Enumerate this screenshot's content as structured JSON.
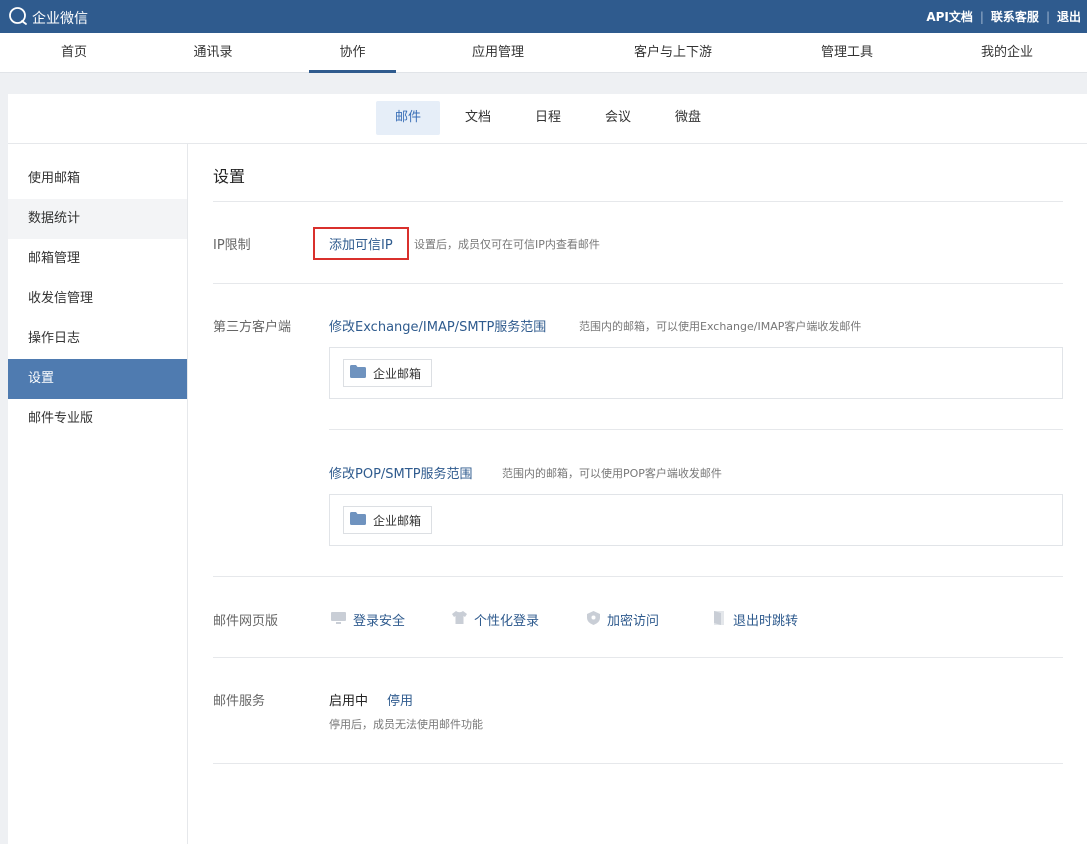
{
  "topbar": {
    "brand": "企业微信",
    "links": [
      "API文档",
      "联系客服",
      "退出"
    ]
  },
  "mainnav": {
    "items": [
      "首页",
      "通讯录",
      "协作",
      "应用管理",
      "客户与上下游",
      "管理工具",
      "我的企业"
    ],
    "active": "协作"
  },
  "subnav": {
    "items": [
      "邮件",
      "文档",
      "日程",
      "会议",
      "微盘"
    ],
    "active": "邮件"
  },
  "sidebar": {
    "items": [
      "使用邮箱",
      "数据统计",
      "邮箱管理",
      "收发信管理",
      "操作日志",
      "设置",
      "邮件专业版"
    ],
    "active": "设置"
  },
  "settings": {
    "title": "设置",
    "ip": {
      "label": "IP限制",
      "action": "添加可信IP",
      "hint": "设置后，成员仅可在可信IP内查看邮件"
    },
    "client": {
      "label": "第三方客户端",
      "exchange_action": "修改Exchange/IMAP/SMTP服务范围",
      "exchange_hint": "范围内的邮箱，可以使用Exchange/IMAP客户端收发邮件",
      "exchange_chip": "企业邮箱",
      "pop_action": "修改POP/SMTP服务范围",
      "pop_hint": "范围内的邮箱，可以使用POP客户端收发邮件",
      "pop_chip": "企业邮箱"
    },
    "web": {
      "label": "邮件网页版",
      "items": [
        "登录安全",
        "个性化登录",
        "加密访问",
        "退出时跳转"
      ]
    },
    "service": {
      "label": "邮件服务",
      "status": "启用中",
      "stop_action": "停用",
      "hint": "停用后，成员无法使用邮件功能"
    }
  },
  "colors": {
    "topbar": "#2f5b8e",
    "accent_link": "#2f5b8e",
    "sidebar_active": "#4f7bb0",
    "highlight_border": "#d9302c"
  }
}
